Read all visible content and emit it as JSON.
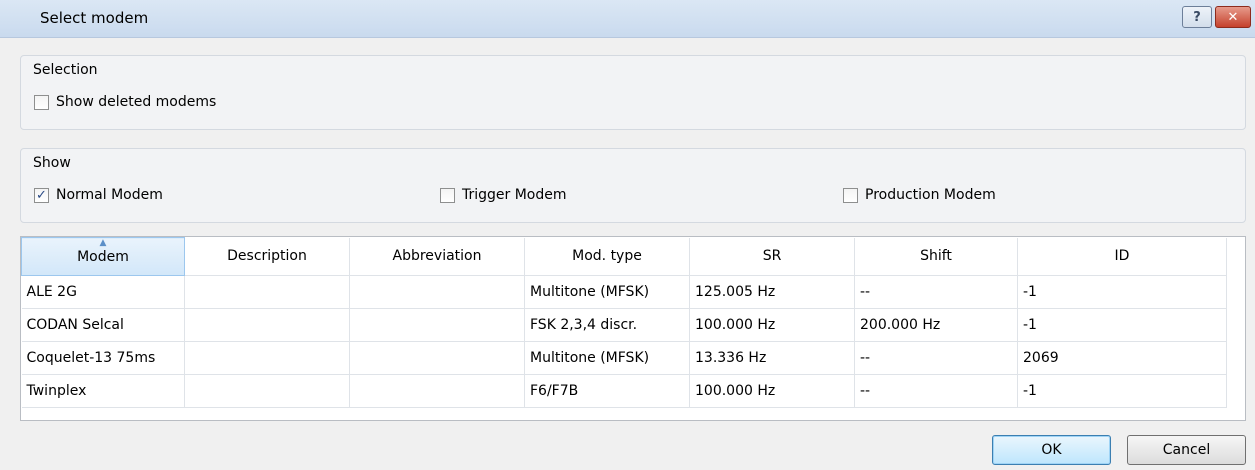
{
  "window": {
    "title": "Select modem",
    "help_glyph": "?",
    "close_glyph": "✕"
  },
  "selection": {
    "title": "Selection",
    "show_deleted": {
      "label": "Show deleted modems",
      "checked": false
    }
  },
  "show": {
    "title": "Show",
    "normal": {
      "label": "Normal Modem",
      "checked": true
    },
    "trigger": {
      "label": "Trigger Modem",
      "checked": false
    },
    "production": {
      "label": "Production Modem",
      "checked": false
    }
  },
  "table": {
    "columns": [
      "Modem",
      "Description",
      "Abbreviation",
      "Mod. type",
      "SR",
      "Shift",
      "ID"
    ],
    "sorted_column": "Modem",
    "rows": [
      [
        "ALE 2G",
        "",
        "",
        "Multitone (MFSK)",
        "125.005 Hz",
        "--",
        "-1"
      ],
      [
        "CODAN Selcal",
        "",
        "",
        "FSK 2,3,4 discr.",
        "100.000 Hz",
        "200.000 Hz",
        "-1"
      ],
      [
        "Coquelet-13 75ms",
        "",
        "",
        "Multitone (MFSK)",
        "13.336 Hz",
        "--",
        "2069"
      ],
      [
        "Twinplex",
        "",
        "",
        "F6/F7B",
        "100.000 Hz",
        "--",
        "-1"
      ]
    ]
  },
  "buttons": {
    "ok": "OK",
    "cancel": "Cancel"
  }
}
